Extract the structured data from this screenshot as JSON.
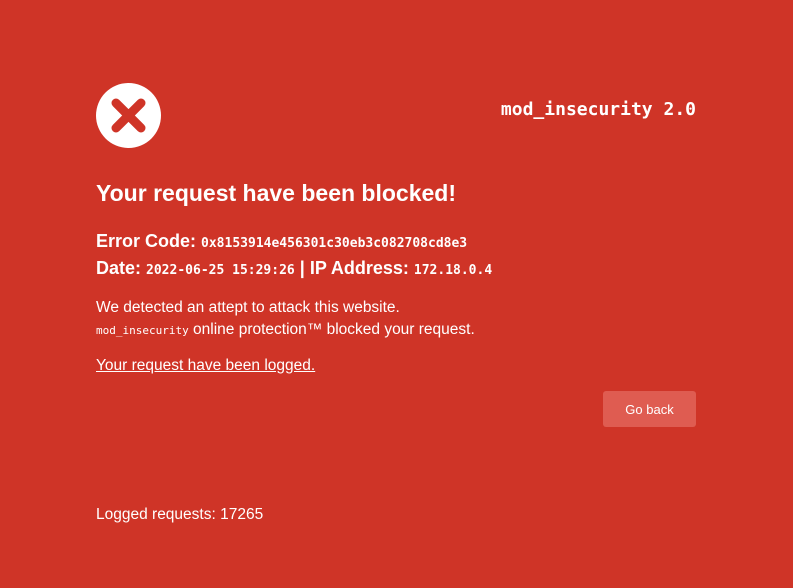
{
  "header": {
    "brand": "mod_insecurity 2.0",
    "status_icon": "error-x-circle-icon"
  },
  "main": {
    "title": "Your request have been blocked!",
    "error_code_label": "Error Code:",
    "error_code_value": "0x8153914e456301c30eb3c082708cd8e3",
    "date_label": "Date:",
    "date_value": "2022-06-25 15:29:26",
    "separator": "|",
    "ip_label": "IP Address:",
    "ip_value": "172.18.0.4",
    "description_line1": "We detected an attept to attack this website.",
    "description_product": "mod_insecurity",
    "description_line2_rest": "online protection™ blocked your request.",
    "logged_link": "Your request have been logged.",
    "go_back_button": "Go back"
  },
  "footer": {
    "logged_requests_label": "Logged requests:",
    "logged_requests_count": "17265"
  },
  "colors": {
    "background": "#cf3427",
    "button": "#df5c51",
    "text": "#ffffff"
  }
}
